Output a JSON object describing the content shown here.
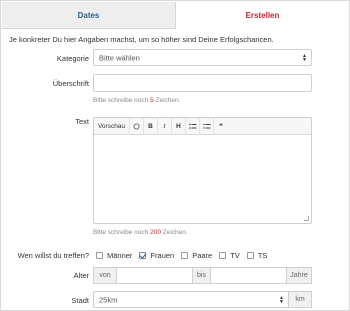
{
  "tabs": [
    {
      "label": "Dates"
    },
    {
      "label": "Erstellen"
    }
  ],
  "intro": "Je konkreter Du hier Angaben machst, um so höher sind Deine Erfolgschancen.",
  "category": {
    "label": "Kategorie",
    "value": "Bitte wählen"
  },
  "headline": {
    "label": "Überschrift",
    "value": "",
    "hint_prefix": "Bitte schreibe noch ",
    "hint_count": "5",
    "hint_suffix": " Zeichen."
  },
  "text": {
    "label": "Text",
    "toolbar": {
      "preview": "Vorschau",
      "bold": "B",
      "italic": "I",
      "heading": "H",
      "quote": "❝"
    },
    "value": "",
    "hint_prefix": "Bitte schreibe noch ",
    "hint_count": "200",
    "hint_suffix": " Zeichen."
  },
  "meet": {
    "label": "Wen willst du treffen?",
    "options": [
      {
        "label": "Männer",
        "checked": false
      },
      {
        "label": "Frauen",
        "checked": true
      },
      {
        "label": "Paare",
        "checked": false
      },
      {
        "label": "TV",
        "checked": false
      },
      {
        "label": "TS",
        "checked": false
      }
    ]
  },
  "age": {
    "label": "Alter",
    "from": "von",
    "to": "bis",
    "unit": "Jahre"
  },
  "city": {
    "label": "Stadt",
    "radius": "25km",
    "unit": "km"
  }
}
